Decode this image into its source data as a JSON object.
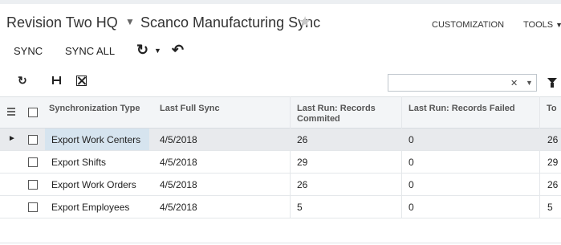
{
  "header": {
    "company": "Revision Two HQ",
    "screen_title": "Scanco Manufacturing Sync",
    "customization_label": "CUSTOMIZATION",
    "tools_label": "TOOLS"
  },
  "toolbar": {
    "sync_label": "SYNC",
    "sync_all_label": "SYNC ALL",
    "refresh_icon": "refresh-icon",
    "undo_icon": "undo-icon"
  },
  "grid_toolbar": {
    "search_value": "",
    "search_placeholder": ""
  },
  "table": {
    "columns": [
      "Synchronization Type",
      "Last Full Sync",
      "Last Run: Records Commited",
      "Last Run: Records Failed",
      "To"
    ],
    "rows": [
      {
        "type": "Export Work Centers",
        "last_full_sync": "4/5/2018",
        "committed": "26",
        "failed": "0",
        "total": "26"
      },
      {
        "type": "Export Shifts",
        "last_full_sync": "4/5/2018",
        "committed": "29",
        "failed": "0",
        "total": "29"
      },
      {
        "type": "Export Work Orders",
        "last_full_sync": "4/5/2018",
        "committed": "26",
        "failed": "0",
        "total": "26"
      },
      {
        "type": "Export Employees",
        "last_full_sync": "4/5/2018",
        "committed": "5",
        "failed": "0",
        "total": "5"
      }
    ]
  },
  "colors": {
    "accent_selected_cell": "#d6e4ef",
    "active_row": "#e8eaed",
    "header_bg": "#f3f5f7"
  }
}
